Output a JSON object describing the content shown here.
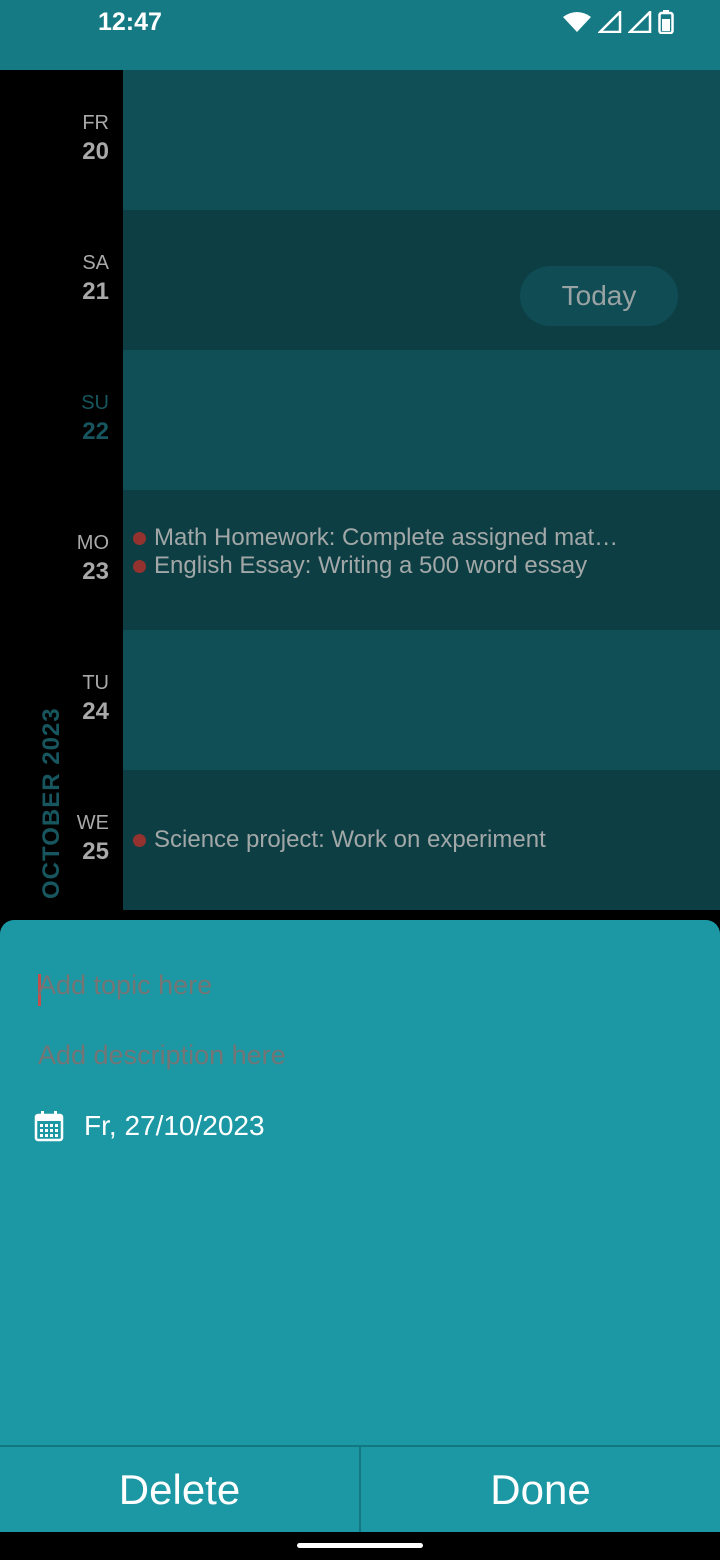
{
  "status": {
    "time": "12:47"
  },
  "calendar": {
    "month_label": "OCTOBER 2023",
    "today_button": "Today",
    "days": [
      {
        "dow": "FR",
        "num": "20"
      },
      {
        "dow": "SA",
        "num": "21"
      },
      {
        "dow": "SU",
        "num": "22",
        "is_today": true
      },
      {
        "dow": "MO",
        "num": "23"
      },
      {
        "dow": "TU",
        "num": "24"
      },
      {
        "dow": "WE",
        "num": "25"
      }
    ],
    "events": {
      "mo23": [
        "Math Homework: Complete assigned mat…",
        "English Essay: Writing a 500 word essay"
      ],
      "we25": [
        "Science project: Work on experiment"
      ]
    }
  },
  "sheet": {
    "topic_placeholder": "Add topic here",
    "description_placeholder": "Add description here",
    "date": "Fr, 27/10/2023",
    "delete_label": "Delete",
    "done_label": "Done"
  },
  "colors": {
    "accent": "#1b98a4",
    "status_bar": "#157a84",
    "event_dot": "#93322f"
  }
}
